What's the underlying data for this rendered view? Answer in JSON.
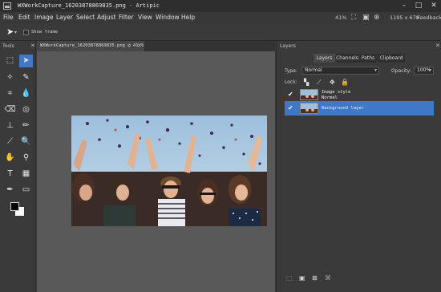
{
  "window": {
    "title": "WXWorkCapture_16203878869835.png - Artipic",
    "icons": [
      "app-icon",
      "minimize-icon",
      "maximize-icon",
      "close-icon"
    ]
  },
  "menu": {
    "items": [
      "File",
      "Edit",
      "Image",
      "Layer",
      "Select",
      "Adjust",
      "Filter",
      "View",
      "Window",
      "Help"
    ],
    "zoom": "41%",
    "image_size": "1195 x 678",
    "feedback": "Feedback"
  },
  "options": {
    "show_frame_label": "Show frame",
    "show_frame_checked": false
  },
  "tools": {
    "title": "Tools",
    "items": [
      {
        "icon": "rect-marquee-icon",
        "active": false
      },
      {
        "icon": "move-arrow-icon",
        "active": true
      },
      {
        "icon": "magic-wand-icon",
        "active": false
      },
      {
        "icon": "brush-icon",
        "active": false
      },
      {
        "icon": "crop-icon",
        "active": false
      },
      {
        "icon": "drop-icon",
        "active": false
      },
      {
        "icon": "eraser-icon",
        "active": false
      },
      {
        "icon": "blur-icon",
        "active": false
      },
      {
        "icon": "stamp-icon",
        "active": false
      },
      {
        "icon": "pencil-icon",
        "active": false
      },
      {
        "icon": "eyedropper-icon",
        "active": false
      },
      {
        "icon": "zoom-icon",
        "active": false
      },
      {
        "icon": "hand-icon",
        "active": false
      },
      {
        "icon": "magnifier-icon",
        "active": false
      },
      {
        "icon": "text-icon",
        "active": false
      },
      {
        "icon": "gradient-icon",
        "active": false
      },
      {
        "icon": "pen-icon",
        "active": false
      },
      {
        "icon": "rectangle-shape-icon",
        "active": false
      }
    ],
    "foreground_color": "#000000",
    "background_color": "#ffffff"
  },
  "document": {
    "tab_label": "WXWorkCapture_16203878869835.png @ 41 %",
    "canvas_bg": "#595959"
  },
  "layers_panel": {
    "title": "Layers",
    "tabs": [
      "Layers",
      "Channels",
      "Paths",
      "Clipboard"
    ],
    "active_tab": "Layers",
    "type_label": "Type:",
    "type_value": "Normal",
    "opacity_label": "Opacity:",
    "opacity_value": "100%",
    "lock_label": "Lock:",
    "lock_icons": [
      "lock-pixels-icon",
      "lock-brush-icon",
      "lock-move-icon",
      "lock-all-icon"
    ],
    "layers": [
      {
        "name": "Image style",
        "mode": "Normal",
        "visible": true,
        "selected": false
      },
      {
        "name": "Background layer",
        "mode": "",
        "visible": true,
        "selected": true
      }
    ],
    "bottom_icons": [
      "new-layer-icon",
      "new-group-icon",
      "delete-layer-icon",
      "attach-icon"
    ],
    "accent": "#3f77c9"
  }
}
